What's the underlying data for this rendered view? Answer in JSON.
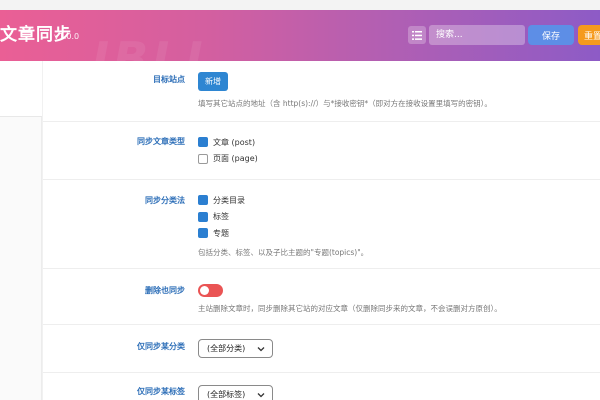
{
  "header": {
    "title": "文章同步",
    "version": "v1.0.0",
    "search_placeholder": "搜索...",
    "save_label": "保存",
    "reset_label": "重置"
  },
  "settings": {
    "target_sites": {
      "label": "目标站点",
      "add_label": "新增",
      "desc": "填写其它站点的地址（含 http(s)://）与*接收密钥*（即对方在接收设置里填写的密钥）。"
    },
    "post_types": {
      "label": "同步文章类型",
      "options": [
        {
          "text": "文章 (post)",
          "checked": true
        },
        {
          "text": "页面 (page)",
          "checked": false
        }
      ]
    },
    "taxonomies": {
      "label": "同步分类法",
      "options": [
        {
          "text": "分类目录",
          "checked": true
        },
        {
          "text": "标签",
          "checked": true
        },
        {
          "text": "专题",
          "checked": true
        }
      ],
      "desc": "包括分类、标签、以及子比主题的\"专题(topics)\"。"
    },
    "delete_sync": {
      "label": "删除也同步",
      "enabled": false,
      "desc": "主站删除文章时，同步删除其它站的对应文章（仅删除同步来的文章，不会误删对方原创）。"
    },
    "only_category": {
      "label": "仅同步某分类",
      "value": "(全部分类)"
    },
    "only_tag": {
      "label": "仅同步某标签",
      "value": "(全部标签)"
    }
  }
}
